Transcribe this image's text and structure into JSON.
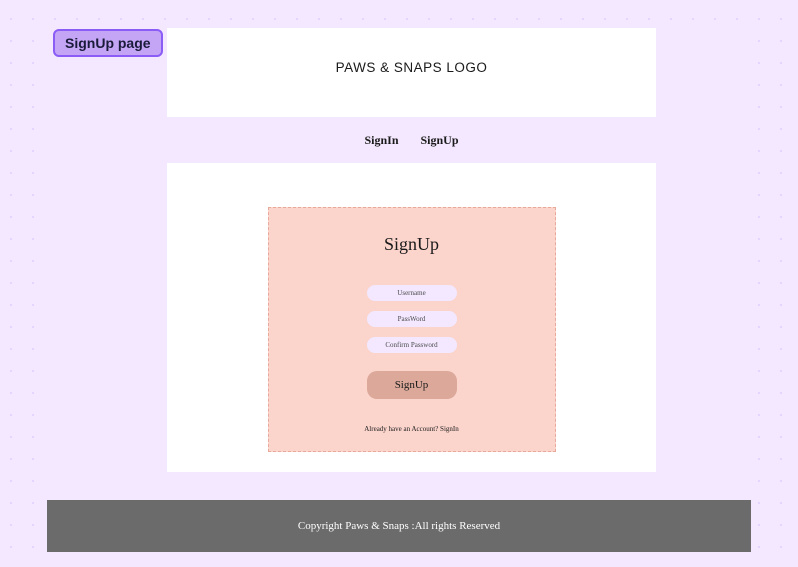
{
  "badge": {
    "label": "SignUp page"
  },
  "header": {
    "logo_text": "PAWS & SNAPS LOGO"
  },
  "tabs": {
    "signin": "SignIn",
    "signup": "SignUp"
  },
  "form": {
    "title": "SignUp",
    "username_placeholder": "Username",
    "password_placeholder": "PassWord",
    "confirm_placeholder": "Confirm Password",
    "submit_label": "SignUp",
    "signin_link_text": "Already have an Account? SignIn"
  },
  "footer": {
    "text": "Copyright Paws & Snaps :All rights Reserved"
  }
}
